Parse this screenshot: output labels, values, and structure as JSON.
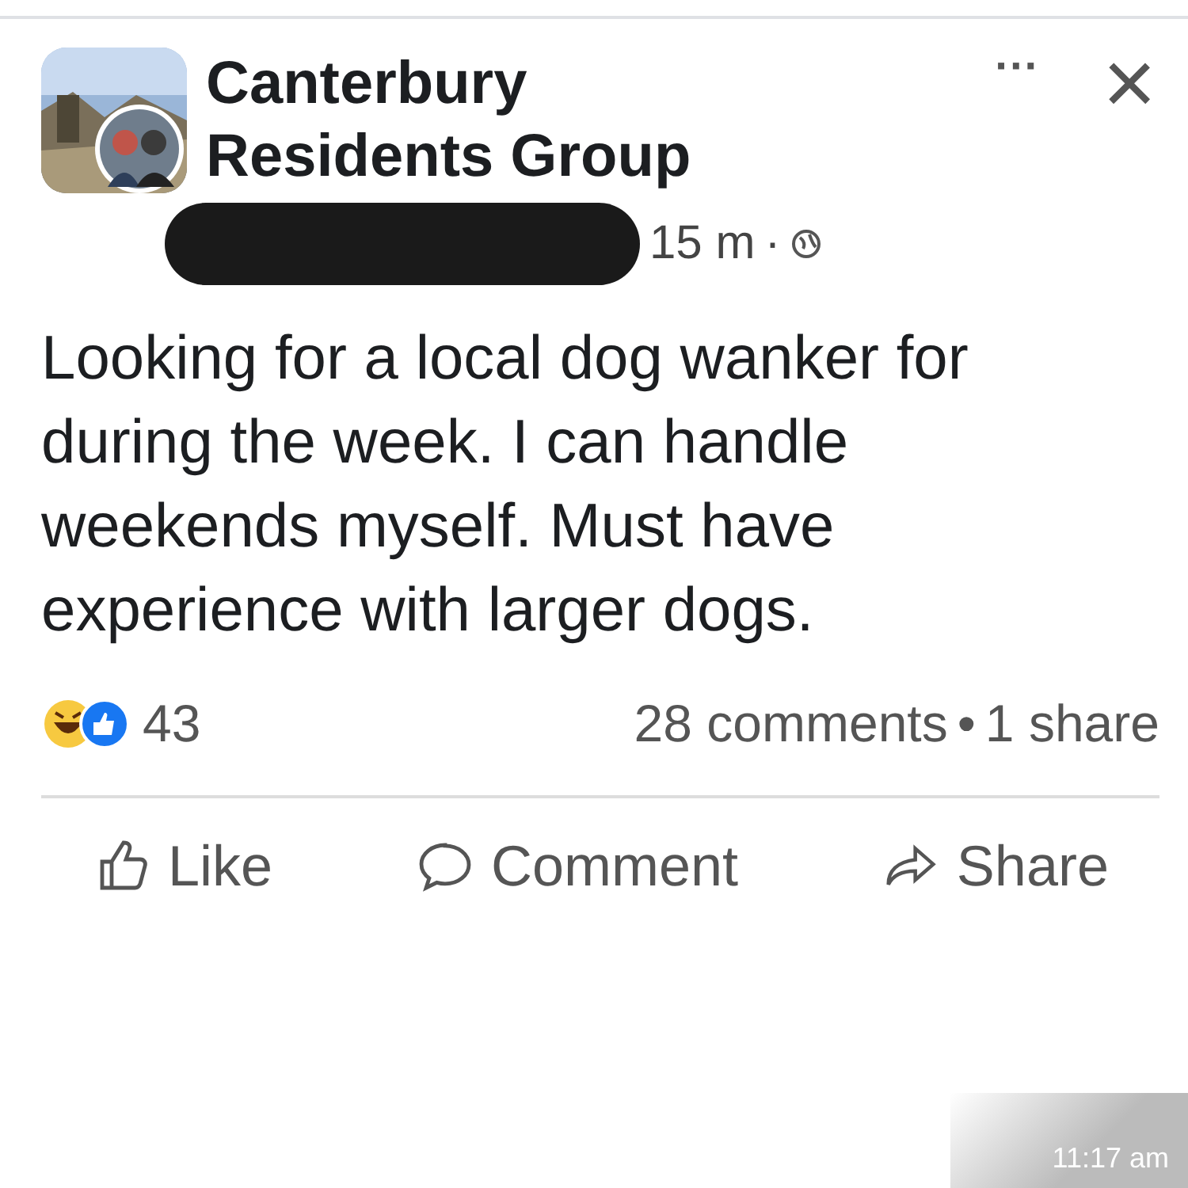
{
  "post": {
    "group": [
      "Canterbury",
      "Residents Group"
    ],
    "time": "15 m",
    "separator": "·",
    "text": "Looking for a local dog wanker for during the week.  I can handle weekends myself. Must have experience with larger dogs.",
    "menu": "···",
    "close": "×"
  },
  "stats": {
    "reactions": "43",
    "comments": "28 comments",
    "dot": "•",
    "shares": "1 share"
  },
  "actions": [
    {
      "kind": "like",
      "label": "Like"
    },
    {
      "kind": "comment",
      "label": "Comment"
    },
    {
      "kind": "share",
      "label": "Share"
    }
  ],
  "overlay": {
    "time": "11:17 am"
  }
}
